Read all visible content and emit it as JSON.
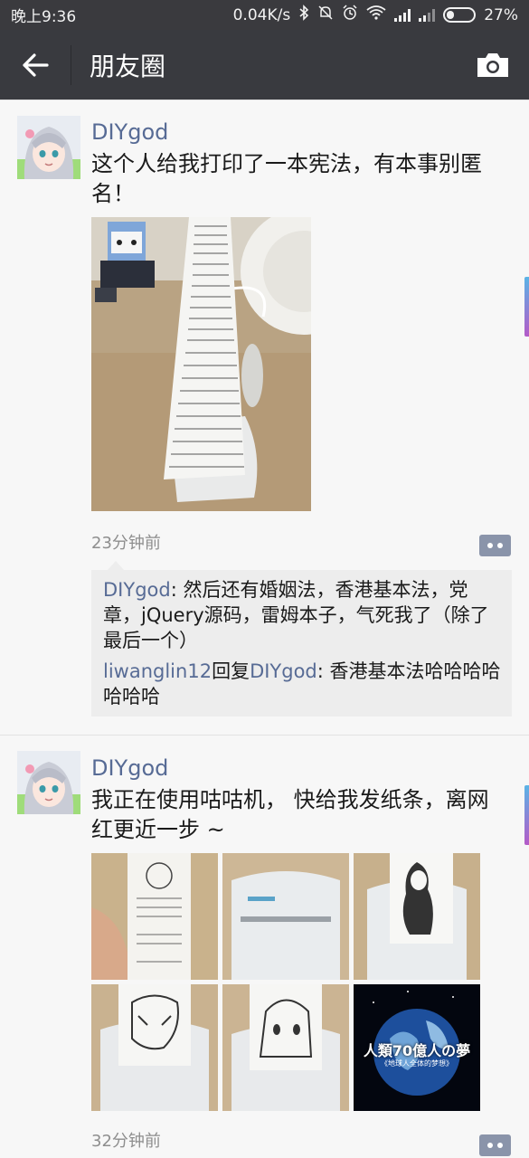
{
  "status_bar": {
    "time": "晚上9:36",
    "net_speed": "0.04K/s",
    "battery_pct": "27%",
    "icons": [
      "bluetooth-icon",
      "mute-icon",
      "alarm-icon",
      "wifi-icon",
      "signal-icon",
      "signal-icon-2",
      "battery-icon"
    ],
    "battery_level": 0.27
  },
  "header": {
    "title": "朋友圈",
    "back_icon": "back-arrow-icon",
    "camera_icon": "camera-icon"
  },
  "posts": [
    {
      "author": "DIYgod",
      "text": "这个人给我打印了一本宪法，有本事别匿名！",
      "time": "23分钟前",
      "comments": [
        {
          "user": "DIYgod",
          "sep": ": ",
          "text": "然后还有婚姻法，香港基本法，党章，jQuery源码，雷姆本子，气死我了（除了最后一个）"
        },
        {
          "user": "liwanglin12",
          "reply_word": "回复",
          "reply_to": "DIYgod",
          "sep": ": ",
          "text": "香港基本法哈哈哈哈哈哈哈"
        }
      ]
    },
    {
      "author": "DIYgod",
      "text": "我正在使用咕咕机，  快给我发纸条，离网红更近一步 ~",
      "time": "32分钟前",
      "photo_overlay_title": "人類70億人の夢",
      "photo_overlay_sub": "《地球人全体的梦想》"
    }
  ],
  "colors": {
    "statusbar_bg": "#3a3a3e",
    "titlebar_bg": "#393a3f",
    "link": "#576b95",
    "page_bg": "#f7f7f7"
  }
}
